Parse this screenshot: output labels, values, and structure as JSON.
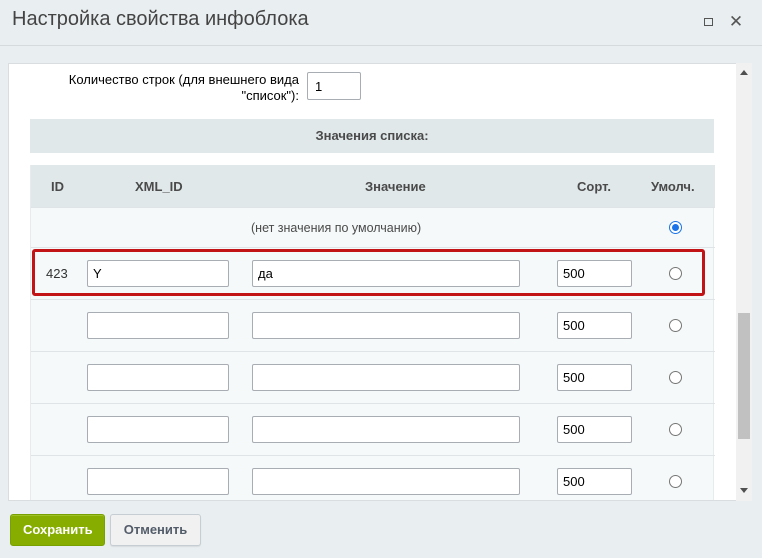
{
  "dialog": {
    "title": "Настройка свойства инфоблока"
  },
  "icons": {
    "maximize": "maximize-icon",
    "close": "close-icon"
  },
  "rows_setting": {
    "label": "Количество строк (для внешнего вида \"список\"):",
    "value": "1"
  },
  "list_values": {
    "section_title": "Значения списка:",
    "columns": {
      "id": "ID",
      "xml_id": "XML_ID",
      "value": "Значение",
      "sort": "Сорт.",
      "default": "Умолч."
    },
    "no_default_text": "(нет значения по умолчанию)",
    "rows": [
      {
        "id": "423",
        "xml_id": "Y",
        "value": "да",
        "sort": "500",
        "default": false
      },
      {
        "id": "",
        "xml_id": "",
        "value": "",
        "sort": "500",
        "default": false
      },
      {
        "id": "",
        "xml_id": "",
        "value": "",
        "sort": "500",
        "default": false
      },
      {
        "id": "",
        "xml_id": "",
        "value": "",
        "sort": "500",
        "default": false
      },
      {
        "id": "",
        "xml_id": "",
        "value": "",
        "sort": "500",
        "default": false
      }
    ]
  },
  "buttons": {
    "save": "Сохранить",
    "cancel": "Отменить"
  },
  "colors": {
    "save_button": "#86ad00",
    "highlight": "#c21317",
    "radio_checked": "#1a73e8"
  }
}
